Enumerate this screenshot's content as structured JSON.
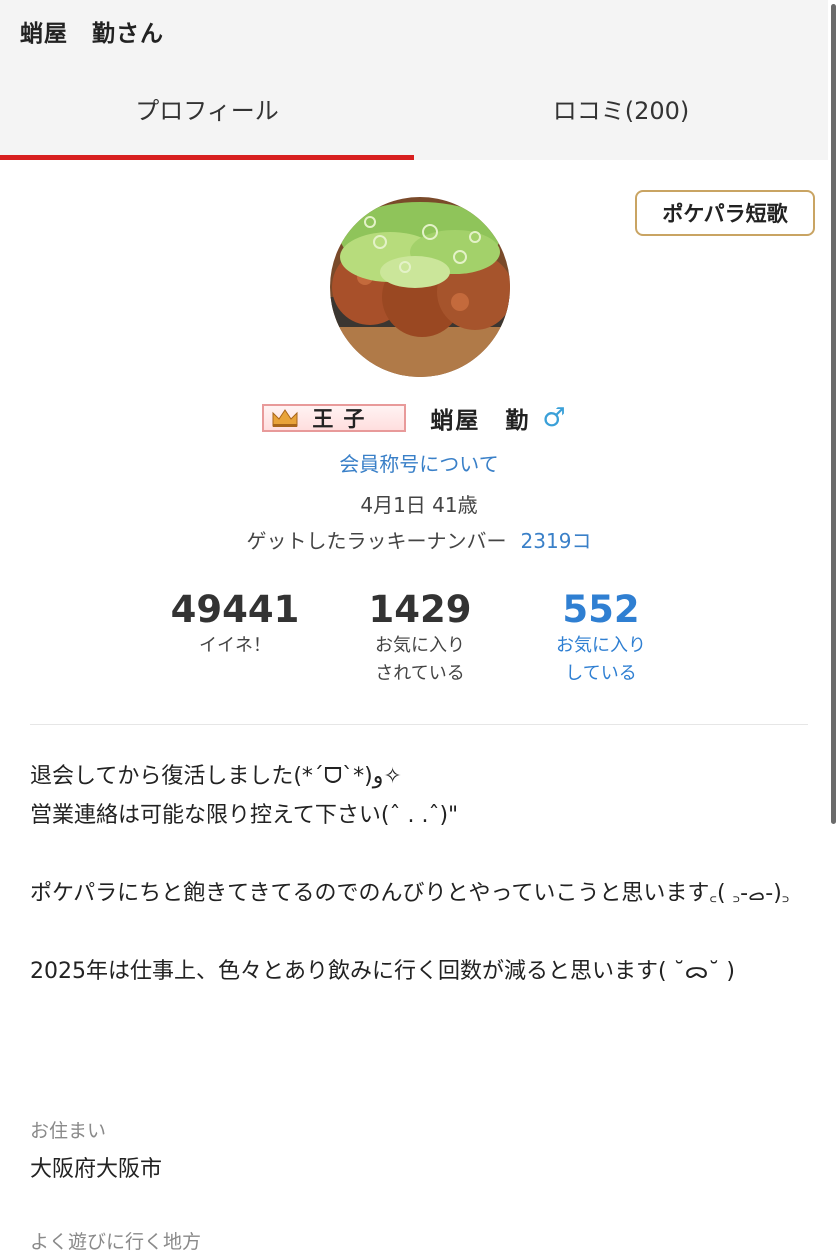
{
  "header": {
    "title": "蛸屋　勤さん"
  },
  "tabs": [
    {
      "label": "プロフィール",
      "active": true
    },
    {
      "label": "ロコミ(200)",
      "active": false
    }
  ],
  "tanka_button": {
    "label": "ポケパラ短歌"
  },
  "profile": {
    "title_badge": "王子",
    "name": "蛸屋　勤",
    "gender_symbol": "♂",
    "rank_link": "会員称号について",
    "birthday": "4月1日 41歳",
    "lucky_label": "ゲットしたラッキーナンバー",
    "lucky_count": "2319コ"
  },
  "stats": [
    {
      "value": "49441",
      "label": "イイネ！",
      "label2": ""
    },
    {
      "value": "1429",
      "label": "お気に入り",
      "label2": "されている"
    },
    {
      "value": "552",
      "label": "お気に入り",
      "label2": "している"
    }
  ],
  "bio": {
    "p1_line1": "退会してから復活しました(*ˊᗜˋ*)و✧",
    "p1_line2": "営業連絡は可能な限り控えて下さい(ˆ . .ˆ)\"",
    "p2": "ポケパラにちと飽きてきてるのでのんびりとやっていこうと思います꜀( ꜆-ࡇ-)꜆",
    "p3": "2025年は仕事上、色々とあり飲みに行く回数が減ると思います( ˘ᯅ˘ )"
  },
  "residence": {
    "label": "お住まい",
    "value": "大阪府大阪市"
  },
  "frequent_area": {
    "label": "よく遊びに行く地方"
  },
  "colors": {
    "accent_red": "#d81f1f",
    "link_blue": "#3a80c8",
    "gold_border": "#c9a463"
  }
}
